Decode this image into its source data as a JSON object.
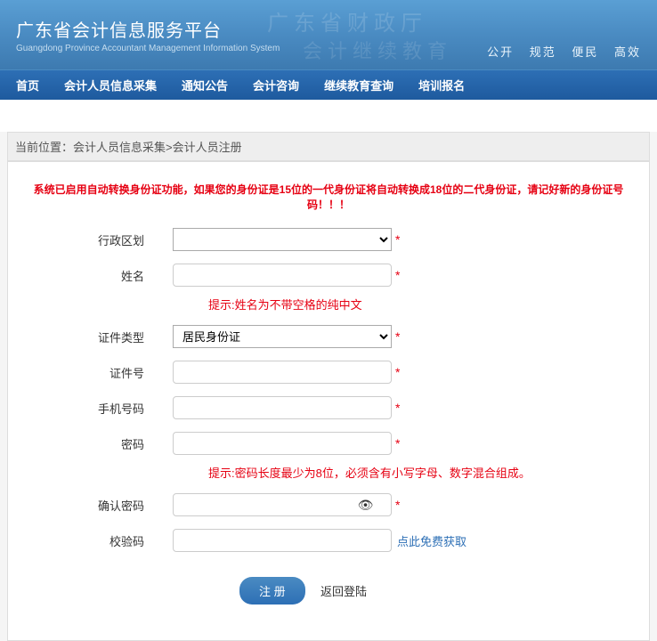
{
  "header": {
    "title": "广东省会计信息服务平台",
    "subtitle": "Guangdong Province Accountant Management Information System",
    "watermark1": "广东省财政厅",
    "watermark2": "会计继续教育",
    "tags": [
      "公开",
      "规范",
      "便民",
      "高效"
    ]
  },
  "nav": {
    "items": [
      "首页",
      "会计人员信息采集",
      "通知公告",
      "会计咨询",
      "继续教育查询",
      "培训报名"
    ]
  },
  "breadcrumb": {
    "prefix": "当前位置：",
    "path": "会计人员信息采集>会计人员注册"
  },
  "warning": "系统已启用自动转换身份证功能，如果您的身份证是15位的一代身份证将自动转换成18位的二代身份证，请记好新的身份证号码！！！",
  "form": {
    "region": {
      "label": "行政区划",
      "value": ""
    },
    "name": {
      "label": "姓名",
      "value": "",
      "hint": "提示:姓名为不带空格的纯中文"
    },
    "idType": {
      "label": "证件类型",
      "value": "居民身份证"
    },
    "idNumber": {
      "label": "证件号",
      "value": ""
    },
    "phone": {
      "label": "手机号码",
      "value": ""
    },
    "password": {
      "label": "密码",
      "value": "",
      "hint": "提示:密码长度最少为8位，必须含有小写字母、数字混合组成。"
    },
    "confirmPassword": {
      "label": "确认密码",
      "value": ""
    },
    "captcha": {
      "label": "校验码",
      "value": "",
      "link": "点此免费获取"
    }
  },
  "actions": {
    "submit": "注 册",
    "back": "返回登陆"
  }
}
